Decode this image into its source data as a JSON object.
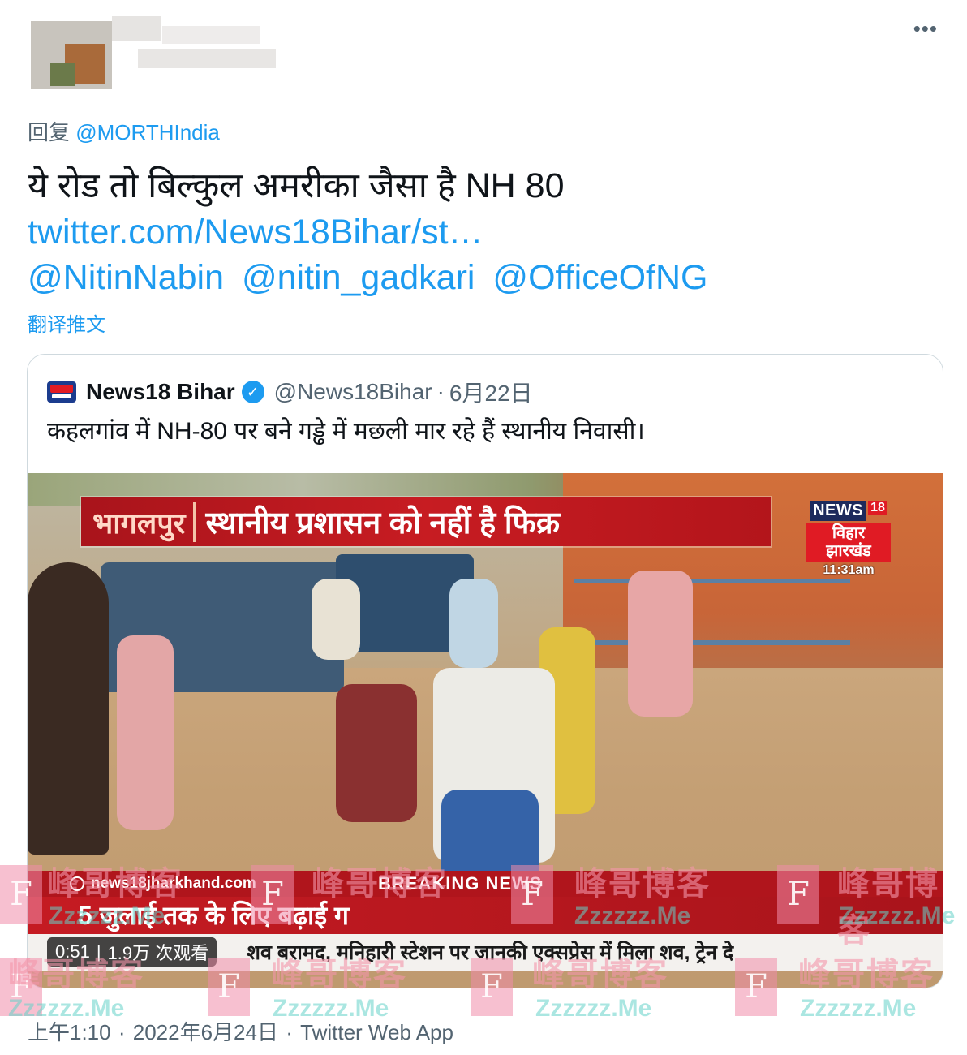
{
  "header": {
    "more_label": "•••"
  },
  "reply": {
    "prefix": "回复",
    "mention": "@MORTHIndia"
  },
  "tweet": {
    "text": "ये रोड तो बिल्कुल अमरीका जैसा है NH 80",
    "link": "twitter.com/News18Bihar/st…",
    "mentions": [
      "@NitinNabin",
      "@nitin_gadkari",
      "@OfficeOfNG"
    ],
    "translate": "翻译推文"
  },
  "quote": {
    "name": "News18 Bihar",
    "handle": "@News18Bihar",
    "separator": "·",
    "date": "6月22日",
    "text": "कहलगांव में NH-80 पर बने गड्ढे में मछली मार रहे हैं स्थानीय निवासी।",
    "video": {
      "location": "भागलपुर",
      "headline": "स्थानीय प्रशासन को नहीं है फिक्र",
      "channel_news": "NEWS",
      "channel_18": "18",
      "channel_region_1": "विहार",
      "channel_region_2": "झारखंड",
      "channel_time": "11:31am",
      "site": "news18jharkhand.com",
      "breaking": "BREAKING NEWS",
      "ticker_main": "5 जुलाई तक के लिए बढ़ाई ग",
      "ticker_scroll": "शव बरामद, मनिहारी स्टेशन पर जानकी एक्सप्रेस में मिला शव, ट्रेन दे",
      "duration": "0:51",
      "views": "1.9万 次观看"
    }
  },
  "footer": {
    "time": "上午1:10",
    "separator": "·",
    "date": "2022年6月24日",
    "separator2": "·",
    "source": "Twitter Web App"
  },
  "watermark": {
    "letter": "F",
    "cn": "峰哥博客",
    "en": "Zzzzzz.Me"
  },
  "colors": {
    "link": "#1d9bf0",
    "secondary_text": "#536471",
    "text": "#0f1419",
    "news_red": "#c71c22"
  }
}
